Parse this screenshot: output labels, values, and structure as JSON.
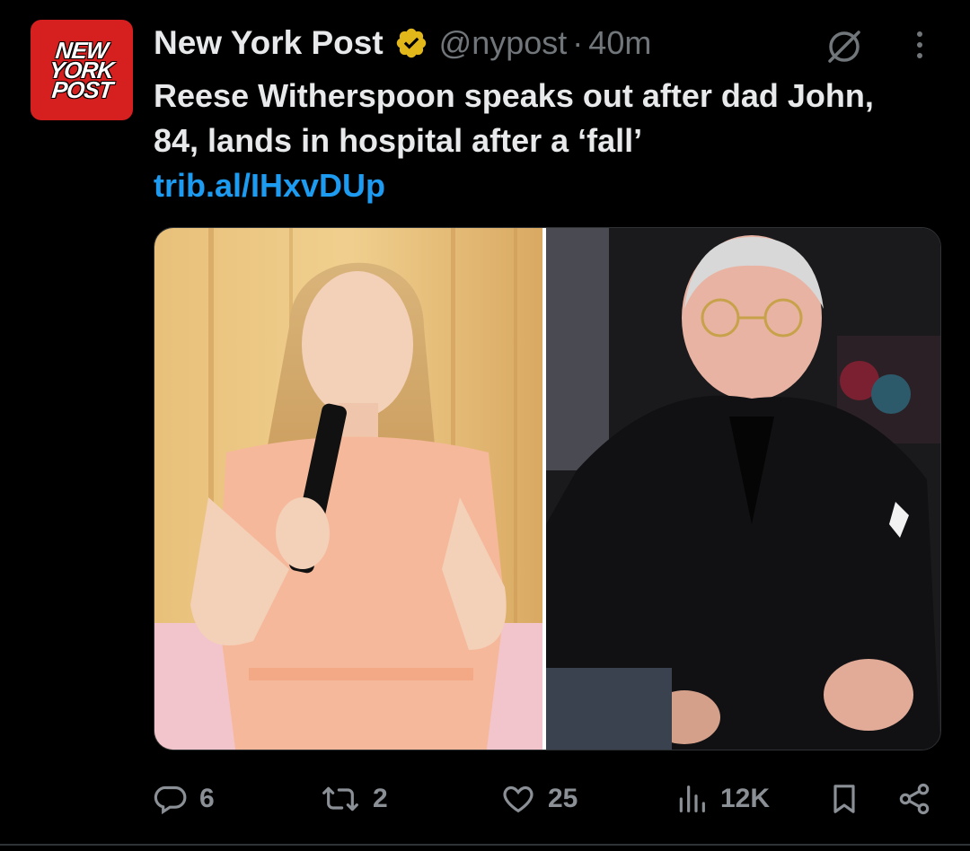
{
  "account": {
    "logo_lines": [
      "NEW",
      "YORK",
      "POST"
    ],
    "display_name": "New York Post",
    "handle": "@nypost",
    "separator": "·",
    "time": "40m",
    "verified_badge": "gold-verified-badge-icon"
  },
  "tweet": {
    "text": "Reese Witherspoon speaks out after dad John, 84, lands in hospital after a ‘fall’",
    "link": "trib.al/IHxvDUp"
  },
  "actions": {
    "replies": "6",
    "reposts": "2",
    "likes": "25",
    "views": "12K"
  },
  "icons": {
    "grok": "grok-icon",
    "more": "more-options-icon",
    "reply": "reply-icon",
    "repost": "repost-icon",
    "like": "heart-icon",
    "views": "views-icon",
    "bookmark": "bookmark-icon",
    "share": "share-icon"
  },
  "colors": {
    "background": "#000000",
    "text": "#e7e9ea",
    "secondary": "#71767b",
    "link": "#1d9bf0",
    "brand_red": "#d61f1f",
    "verified_gold": "#e2b719"
  }
}
